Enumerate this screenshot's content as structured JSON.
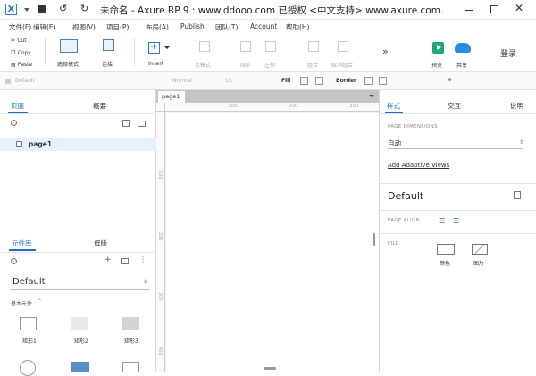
{
  "titlebar": {
    "app_icon": "X",
    "title": "未命名 - Axure RP 9 : www.ddooo.com 已授权    <中文支持> www.axure.com.cn..."
  },
  "menu": [
    "文件(F)",
    "编辑(E)",
    "视图(V)",
    "项目(P)",
    "布局(A)",
    "Publish",
    "团队(T)",
    "Account",
    "帮助(H)"
  ],
  "toolbar": {
    "clipboard": [
      "Cut",
      "Copy",
      "Paste"
    ],
    "select_mode": "选择模式",
    "connect": "连接",
    "insert": "Insert",
    "disabled": [
      "点模式",
      "顶部",
      "左侧",
      "组合",
      "取消组合"
    ],
    "preview": "预览",
    "share": "共享",
    "login": "登录",
    "more": "»"
  },
  "format": {
    "style": "Default",
    "font": "Normal",
    "size": "13",
    "fill": "Fill",
    "border": "Border",
    "more": "»"
  },
  "left": {
    "tabs": [
      "页面",
      "概要"
    ],
    "page_item": "page1",
    "lib_tabs": [
      "元件库",
      "母版"
    ],
    "library": "Default",
    "lib_section": "基本元件",
    "shapes": [
      "矩形1",
      "矩形2",
      "矩形3"
    ]
  },
  "canvas": {
    "tab": "page1",
    "ruler_h": [
      "100",
      "200",
      "300"
    ],
    "ruler_v": [
      "100",
      "200",
      "300",
      "400"
    ]
  },
  "right": {
    "tabs": [
      "样式",
      "交互",
      "说明"
    ],
    "page_dimensions_label": "PAGE DIMENSIONS",
    "page_dimensions_value": "自动",
    "adaptive_link": "Add Adaptive Views",
    "style_name": "Default",
    "page_align_label": "PAGE ALIGN",
    "fill_label": "FILL",
    "fill_options": [
      "颜色",
      "图片"
    ]
  },
  "colors": {
    "accent": "#1a6fc7",
    "preview_green": "#1aaa7a",
    "share_blue": "#2b8ae2"
  }
}
